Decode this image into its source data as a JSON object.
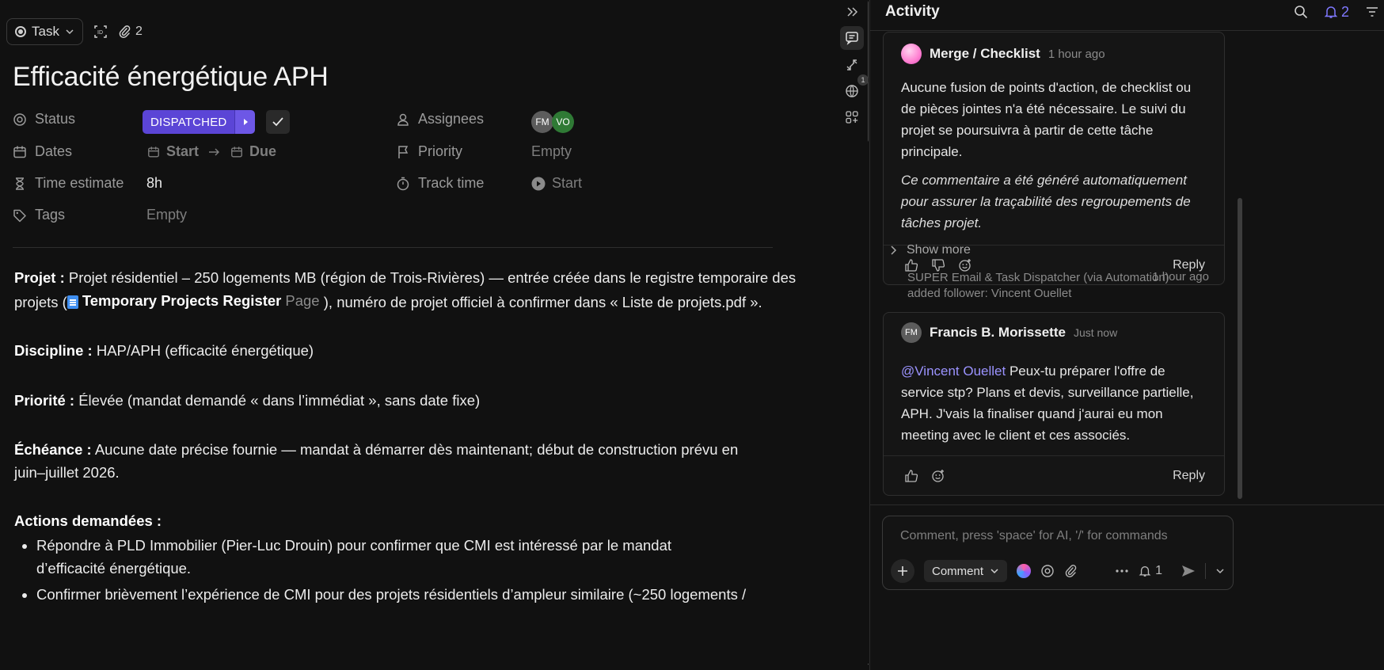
{
  "task": {
    "type_label": "Task",
    "attachments_count": "2",
    "title": "Efficacité énergétique APH"
  },
  "fields": {
    "status_label": "Status",
    "status_value": "DISPATCHED",
    "assignees_label": "Assignees",
    "assignees": [
      {
        "initials": "FM",
        "color": "#5c5c5c"
      },
      {
        "initials": "VO",
        "color": "#2f7a35"
      }
    ],
    "dates_label": "Dates",
    "start_label": "Start",
    "due_label": "Due",
    "priority_label": "Priority",
    "priority_value": "Empty",
    "time_estimate_label": "Time estimate",
    "time_estimate_value": "8h",
    "track_time_label": "Track time",
    "track_time_value": "Start",
    "tags_label": "Tags",
    "tags_value": "Empty"
  },
  "description": {
    "projet_label": "Projet :",
    "projet_text_1": "Projet résidentiel – 250 logements MB (région de Trois-Rivières) — entrée créée dans le registre temporaire des projets (",
    "doc_link": "Temporary Projects Register",
    "doc_tag": "Page",
    "projet_text_2": "), numéro de projet officiel à confirmer dans « Liste de projets.pdf ».",
    "discipline_label": "Discipline :",
    "discipline_text": "HAP/APH (efficacité énergétique)",
    "priorite_label": "Priorité :",
    "priorite_text": "Élevée (mandat demandé « dans l’immédiat », sans date fixe)",
    "echeance_label": "Échéance :",
    "echeance_text": "Aucune date précise fournie — mandat à démarrer dès maintenant; début de construction prévu en juin–juillet 2026.",
    "actions_label": "Actions demandées :",
    "actions": [
      "Répondre à PLD Immobilier (Pier-Luc Drouin) pour confirmer que CMI est intéressé par le mandat d’efficacité énergétique.",
      "Confirmer brièvement l’expérience de CMI pour des projets résidentiels d’ampleur similaire (~250 logements /"
    ]
  },
  "rail": {
    "globe_badge": "1"
  },
  "activity": {
    "title": "Activity",
    "bell_count": "2",
    "card1": {
      "author": "Merge / Checklist",
      "time": "1 hour ago",
      "para1": "Aucune fusion de points d'action, de checklist ou de pièces jointes n'a été nécessaire. Le suivi du projet se poursuivra à partir de cette tâche principale.",
      "para2": "Ce commentaire a été généré automatiquement pour assurer la traçabilité des regroupements de tâches projet.",
      "reply": "Reply"
    },
    "show_more": "Show more",
    "event": {
      "line1": "SUPER Email & Task Dispatcher (via Automation)",
      "line2": "added follower: Vincent Ouellet",
      "time": "1 hour ago"
    },
    "card2": {
      "initials": "FM",
      "author": "Francis B. Morissette",
      "time": "Just now",
      "mention": "@Vincent Ouellet",
      "text": " Peux-tu préparer l'offre de service stp? Plans et devis, surveillance partielle, APH. J'vais la finaliser quand j'aurai eu mon meeting avec le client et ces associés.",
      "reply": "Reply"
    },
    "composer": {
      "placeholder": "Comment, press 'space' for AI, '/' for commands",
      "comment_btn": "Comment",
      "notify_count": "1"
    }
  }
}
